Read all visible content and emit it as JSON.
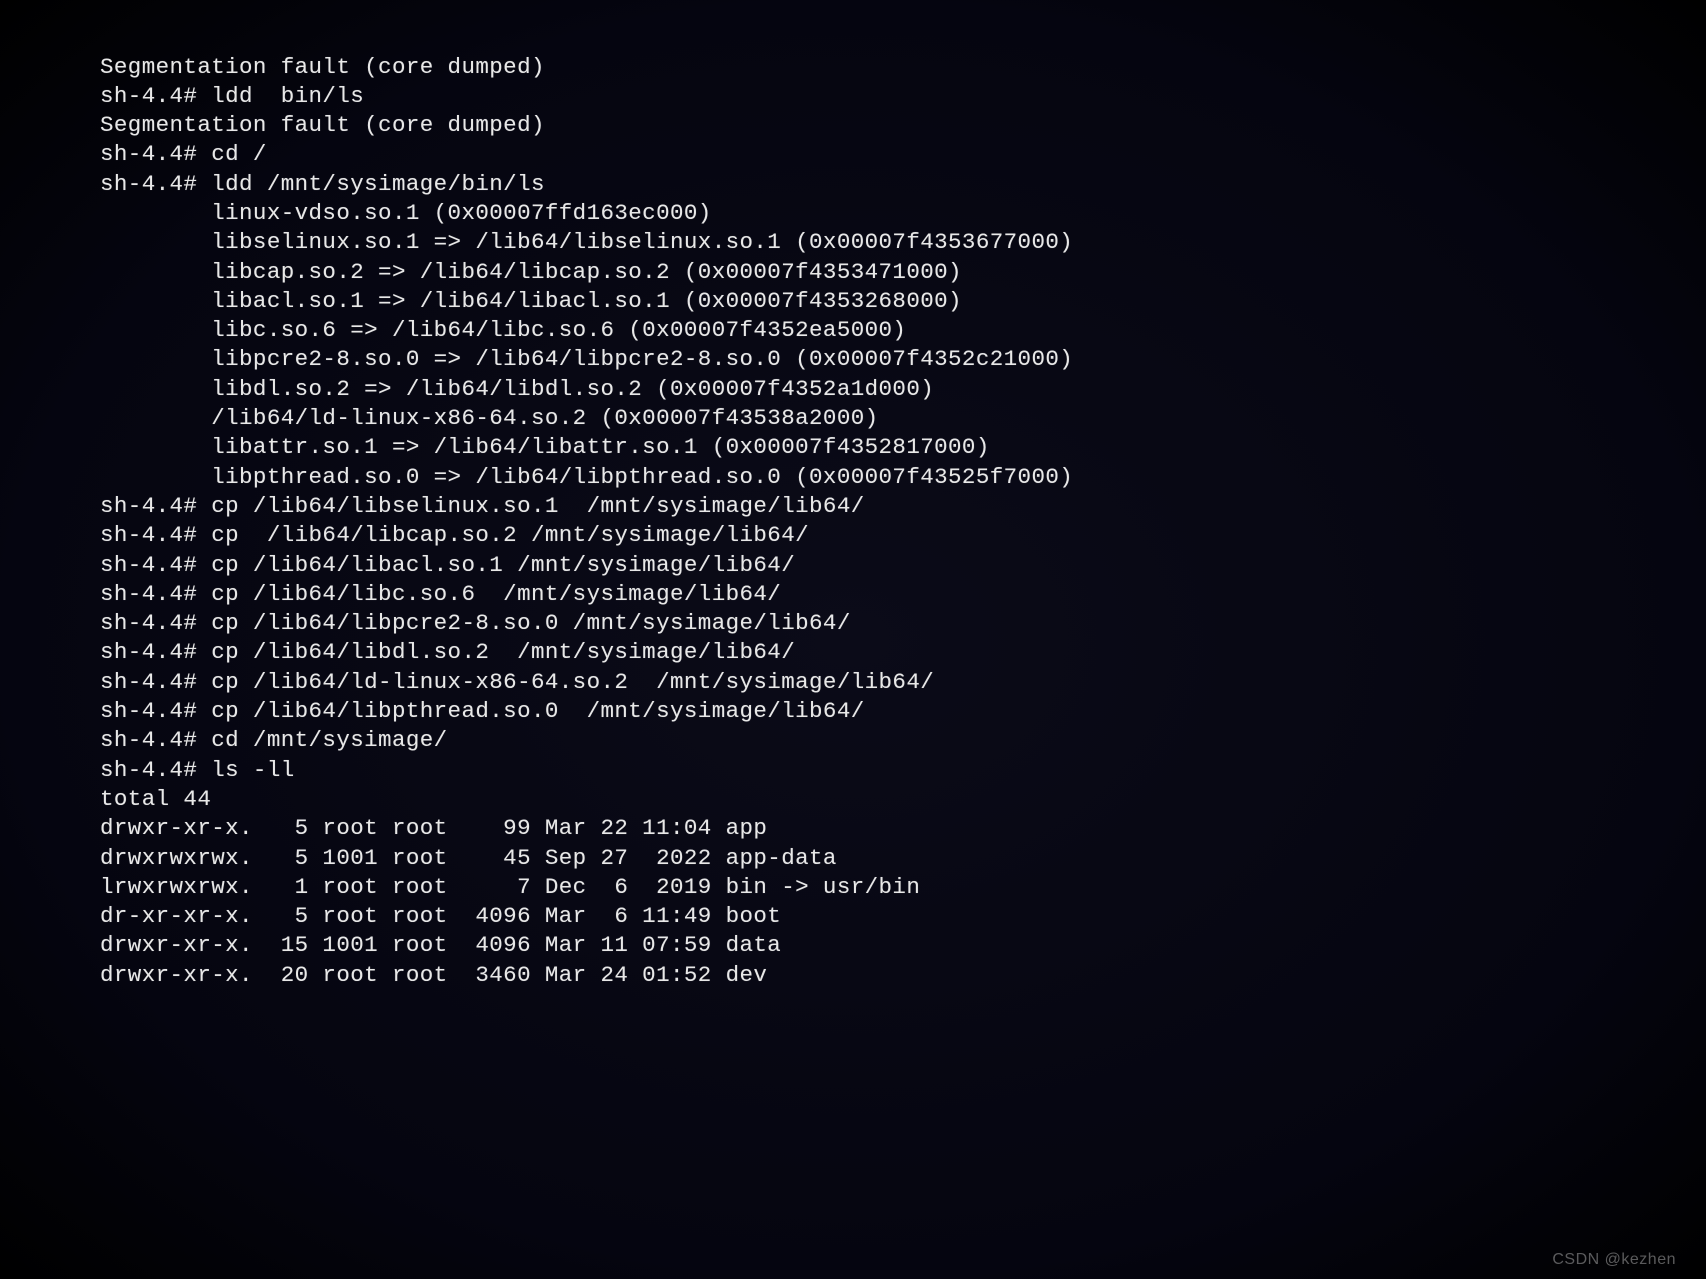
{
  "prompt": "sh-4.4#",
  "segfault": "Segmentation fault (core dumped)",
  "cmd_ldd_bin_ls": "ldd  bin/ls",
  "cmd_cd_root": "cd /",
  "cmd_ldd_mnt": "ldd /mnt/sysimage/bin/ls",
  "ldd_output": [
    "linux-vdso.so.1 (0x00007ffd163ec000)",
    "libselinux.so.1 => /lib64/libselinux.so.1 (0x00007f4353677000)",
    "libcap.so.2 => /lib64/libcap.so.2 (0x00007f4353471000)",
    "libacl.so.1 => /lib64/libacl.so.1 (0x00007f4353268000)",
    "libc.so.6 => /lib64/libc.so.6 (0x00007f4352ea5000)",
    "libpcre2-8.so.0 => /lib64/libpcre2-8.so.0 (0x00007f4352c21000)",
    "libdl.so.2 => /lib64/libdl.so.2 (0x00007f4352a1d000)",
    "/lib64/ld-linux-x86-64.so.2 (0x00007f43538a2000)",
    "libattr.so.1 => /lib64/libattr.so.1 (0x00007f4352817000)",
    "libpthread.so.0 => /lib64/libpthread.so.0 (0x00007f43525f7000)"
  ],
  "cp_cmds": [
    "cp /lib64/libselinux.so.1  /mnt/sysimage/lib64/",
    "cp  /lib64/libcap.so.2 /mnt/sysimage/lib64/",
    "cp /lib64/libacl.so.1 /mnt/sysimage/lib64/",
    "cp /lib64/libc.so.6  /mnt/sysimage/lib64/",
    "cp /lib64/libpcre2-8.so.0 /mnt/sysimage/lib64/",
    "cp /lib64/libdl.so.2  /mnt/sysimage/lib64/",
    "cp /lib64/ld-linux-x86-64.so.2  /mnt/sysimage/lib64/",
    "cp /lib64/libpthread.so.0  /mnt/sysimage/lib64/"
  ],
  "cmd_cd_sysimage": "cd /mnt/sysimage/",
  "cmd_ls": "ls -ll",
  "ls_total": "total 44",
  "ls_rows": [
    {
      "perm": "drwxr-xr-x.",
      "links": "5",
      "owner": "root",
      "group": "root",
      "size": "99",
      "month": "Mar",
      "day": "22",
      "time": "11:04",
      "name": "app"
    },
    {
      "perm": "drwxrwxrwx.",
      "links": "5",
      "owner": "1001",
      "group": "root",
      "size": "45",
      "month": "Sep",
      "day": "27",
      "time": " 2022",
      "name": "app-data"
    },
    {
      "perm": "lrwxrwxrwx.",
      "links": "1",
      "owner": "root",
      "group": "root",
      "size": "7",
      "month": "Dec",
      "day": "6",
      "time": " 2019",
      "name": "bin -> usr/bin"
    },
    {
      "perm": "dr-xr-xr-x.",
      "links": "5",
      "owner": "root",
      "group": "root",
      "size": "4096",
      "month": "Mar",
      "day": "6",
      "time": "11:49",
      "name": "boot"
    },
    {
      "perm": "drwxr-xr-x.",
      "links": "15",
      "owner": "1001",
      "group": "root",
      "size": "4096",
      "month": "Mar",
      "day": "11",
      "time": "07:59",
      "name": "data"
    },
    {
      "perm": "drwxr-xr-x.",
      "links": "20",
      "owner": "root",
      "group": "root",
      "size": "3460",
      "month": "Mar",
      "day": "24",
      "time": "01:52",
      "name": "dev"
    }
  ],
  "watermark": "CSDN @kezhen"
}
